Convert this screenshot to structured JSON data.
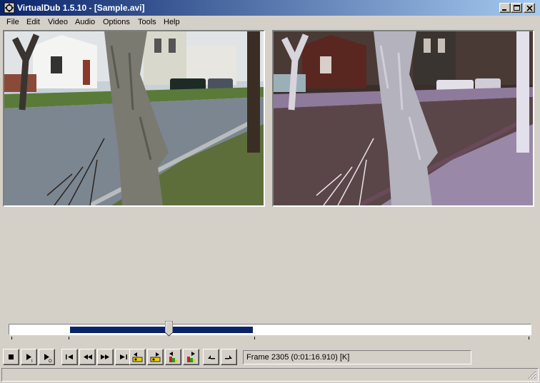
{
  "window": {
    "title": "VirtualDub 1.5.10 - [Sample.avi]",
    "controls": {
      "minimize_icon": "minimize-icon",
      "maximize_icon": "maximize-icon",
      "close_icon": "close-icon"
    }
  },
  "menu": {
    "items": [
      "File",
      "Edit",
      "Video",
      "Audio",
      "Options",
      "Tools",
      "Help"
    ]
  },
  "panes": {
    "input_icon": "video-frame",
    "output_icon": "video-frame-inverted"
  },
  "timeline": {
    "position_fraction": 0.305,
    "selection_start_fraction": 0.117,
    "selection_end_fraction": 0.468
  },
  "toolbar": {
    "buttons": [
      "stop-icon",
      "play-input-icon",
      "play-output-icon",
      "go-start-icon",
      "step-back-icon",
      "step-forward-icon",
      "go-end-icon",
      "prev-keyframe-icon",
      "next-keyframe-icon",
      "prev-scene-icon",
      "next-scene-icon",
      "mark-in-icon",
      "mark-out-icon"
    ]
  },
  "status": {
    "frame_text": "Frame 2305 (0:01:16.910) [K]"
  },
  "colors": {
    "titlebar_start": "#0a246a",
    "titlebar_end": "#a6caf0",
    "selection": "#0a246a",
    "face": "#d4d0c8"
  }
}
